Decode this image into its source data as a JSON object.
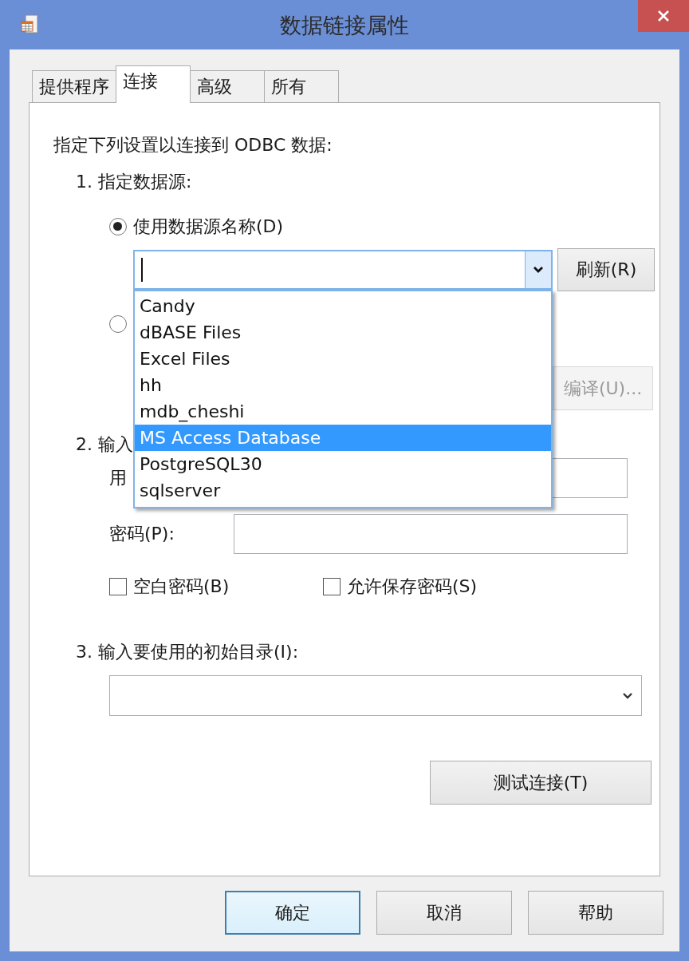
{
  "window": {
    "title": "数据链接属性"
  },
  "tabs": [
    {
      "label": "提供程序",
      "selected": false
    },
    {
      "label": "连接",
      "selected": true
    },
    {
      "label": "高级",
      "selected": false
    },
    {
      "label": "所有",
      "selected": false
    }
  ],
  "intro": "指定下列设置以连接到 ODBC 数据:",
  "step1": {
    "label": "1. 指定数据源:",
    "radios": [
      {
        "label": "使用数据源名称(D)",
        "selected": true
      },
      {
        "selected": false
      }
    ],
    "refresh_button": "刷新(R)",
    "compile_button": {
      "label": "编译(U)...",
      "disabled": true
    },
    "dropdown_items": [
      {
        "label": "Candy",
        "selected": false
      },
      {
        "label": "dBASE Files",
        "selected": false
      },
      {
        "label": "Excel Files",
        "selected": false
      },
      {
        "label": "hh",
        "selected": false
      },
      {
        "label": "mdb_cheshi",
        "selected": false
      },
      {
        "label": "MS Access Database",
        "selected": true
      },
      {
        "label": "PostgreSQL30",
        "selected": false
      },
      {
        "label": "sqlserver",
        "selected": false
      }
    ]
  },
  "step2": {
    "label": "2. 输入",
    "user_label": "用",
    "password_label": "密码(P):",
    "checkboxes": [
      {
        "label": "空白密码(B)",
        "checked": false
      },
      {
        "label": "允许保存密码(S)",
        "checked": false
      }
    ]
  },
  "step3": {
    "label": "3. 输入要使用的初始目录(I):"
  },
  "test_button": "测试连接(T)",
  "buttons": [
    "确定",
    "取消",
    "帮助"
  ]
}
